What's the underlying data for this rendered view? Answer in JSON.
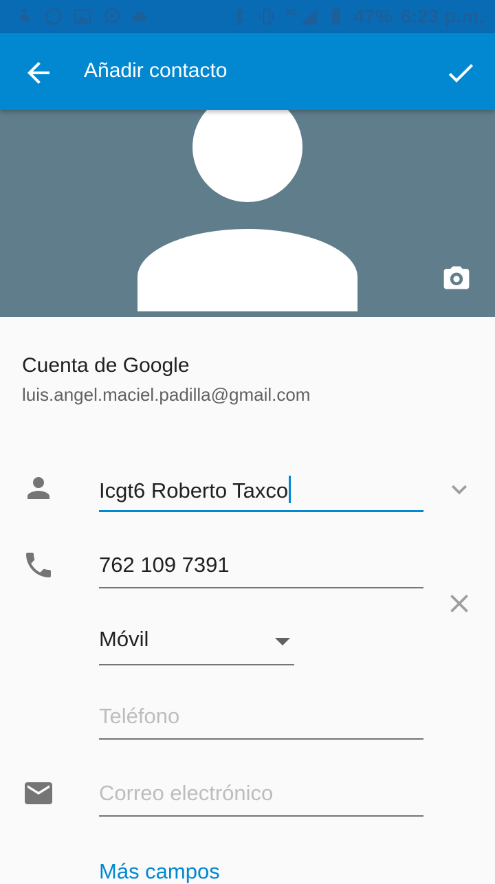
{
  "status_bar": {
    "battery": "47%",
    "time": "6:23 p.m.",
    "network": "3G",
    "left_icons": [
      "usb-icon",
      "whatsapp-icon",
      "image-icon",
      "messenger-icon",
      "cloud-icon"
    ],
    "right_icons": [
      "bluetooth-icon",
      "vibrate-icon",
      "signal-icon",
      "battery-icon"
    ]
  },
  "toolbar": {
    "title": "Añadir contacto",
    "back_icon": "arrow-back-icon",
    "save_icon": "check-icon",
    "color": "#0288d1"
  },
  "photo": {
    "background": "#607d8b",
    "camera_icon": "camera-icon"
  },
  "account": {
    "label": "Cuenta de Google",
    "email": "luis.angel.maciel.padilla@gmail.com"
  },
  "form": {
    "name": {
      "value": "Icgt6 Roberto Taxco",
      "icon": "person-icon",
      "expand_icon": "chevron-down-icon"
    },
    "phone": {
      "value": "762 109 7391",
      "icon": "phone-icon",
      "clear_icon": "close-icon"
    },
    "phone_type": {
      "selected": "Móvil"
    },
    "phone2": {
      "placeholder": "Teléfono"
    },
    "email": {
      "placeholder": "Correo electrónico",
      "icon": "email-icon"
    },
    "more_fields": "Más campos"
  }
}
